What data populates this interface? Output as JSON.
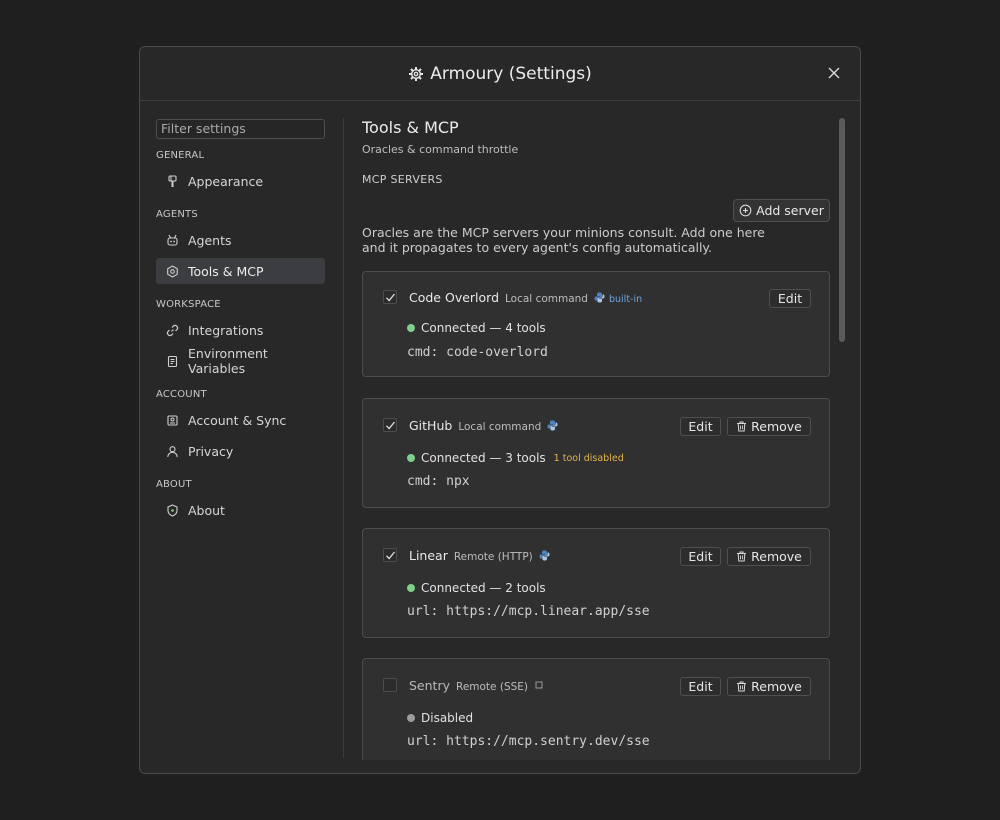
{
  "window": {
    "title": "Armoury (Settings)"
  },
  "sidebar": {
    "filter_placeholder": "Filter settings",
    "sections": [
      {
        "label": "GENERAL",
        "items": [
          {
            "label": "Appearance",
            "icon": "paintbrush-icon"
          }
        ]
      },
      {
        "label": "AGENTS",
        "items": [
          {
            "label": "Agents",
            "icon": "robot-icon"
          },
          {
            "label": "Tools & MCP",
            "icon": "gear-icon",
            "active": true
          }
        ]
      },
      {
        "label": "WORKSPACE",
        "items": [
          {
            "label": "Integrations",
            "icon": "link-icon"
          },
          {
            "label": "Environment Variables",
            "icon": "document-icon"
          }
        ]
      },
      {
        "label": "ACCOUNT",
        "items": [
          {
            "label": "Account & Sync",
            "icon": "id-card-icon"
          },
          {
            "label": "Privacy",
            "icon": "person-icon"
          }
        ]
      },
      {
        "label": "ABOUT",
        "items": [
          {
            "label": "About",
            "icon": "shield-icon"
          }
        ]
      }
    ]
  },
  "main": {
    "title": "Tools & MCP",
    "subtitle": "Oracles & command throttle",
    "section_label": "MCP SERVERS",
    "add_server_label": "Add server",
    "description": "Oracles are the MCP servers your minions consult. Add one here and it propagates to every agent's config automatically.",
    "servers": [
      {
        "name": "Code Overlord",
        "kind": "Local command",
        "badge": "built-in",
        "enabled": true,
        "status": "Connected — 4 tools",
        "status_color": "#7fcf8a",
        "warning": "",
        "detail": "cmd: code-overlord",
        "edit_label": "Edit",
        "remove_label": ""
      },
      {
        "name": "GitHub",
        "kind": "Local command",
        "badge": "",
        "enabled": true,
        "status": "Connected — 3 tools",
        "status_color": "#7fcf8a",
        "warning": "1 tool disabled",
        "detail": "cmd: npx",
        "edit_label": "Edit",
        "remove_label": "Remove"
      },
      {
        "name": "Linear",
        "kind": "Remote (HTTP)",
        "badge": "",
        "enabled": true,
        "status": "Connected — 2 tools",
        "status_color": "#7fcf8a",
        "warning": "",
        "detail": "url: https://mcp.linear.app/sse",
        "edit_label": "Edit",
        "remove_label": "Remove"
      },
      {
        "name": "Sentry",
        "kind": "Remote (SSE)",
        "badge": "",
        "enabled": false,
        "status": "Disabled",
        "status_color": "#9b9b9b",
        "warning": "",
        "detail": "url: https://mcp.sentry.dev/sse",
        "edit_label": "Edit",
        "remove_label": "Remove"
      }
    ]
  },
  "colors": {
    "accent_blue": "#6da3e0",
    "connected_green": "#7fcf8a",
    "warning_amber": "#e3b34f",
    "active_nav_bg": "#3b3d40"
  }
}
